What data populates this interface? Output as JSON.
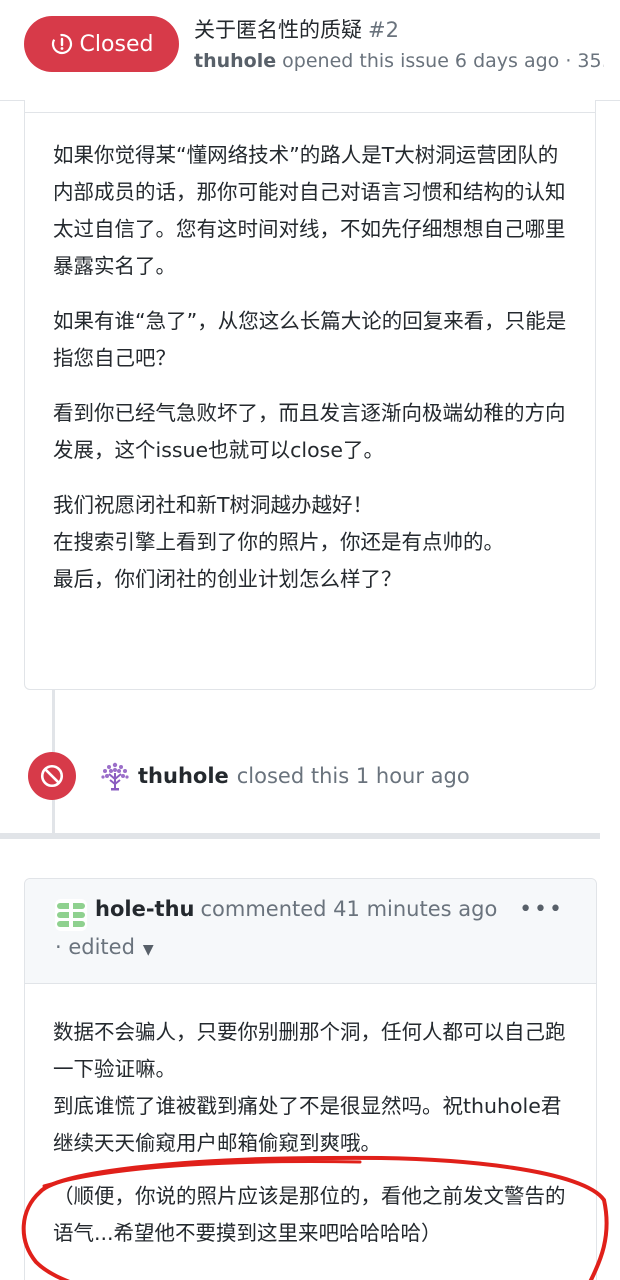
{
  "header": {
    "state_label": "Closed",
    "title": "关于匿名性的质疑",
    "number": "#2",
    "meta_author": "thuhole",
    "meta_rest": "opened this issue 6 days ago · 35…"
  },
  "comment1": {
    "paragraphs": [
      "如果你觉得某“懂网络技术”的路人是T大树洞运营团队的内部成员的话，那你可能对自己对语言习惯和结构的认知太过自信了。您有这时间对线，不如先仔细想想自己哪里暴露实名了。",
      "如果有谁“急了”，从您这么长篇大论的回复来看，只能是指您自己吧？",
      "看到你已经气急败坏了，而且发言逐渐向极端幼稚的方向发展，这个issue也就可以close了。"
    ],
    "last_lines": [
      "我们祝愿闭社和新T树洞越办越好！",
      "在搜索引擎上看到了你的照片，你还是有点帅的。",
      "最后，你们闭社的创业计划怎么样了？"
    ]
  },
  "event": {
    "icon": "closed-circle-slash-icon",
    "author": "thuhole",
    "text": "closed this 1 hour ago"
  },
  "comment2": {
    "author": "hole-thu",
    "meta": "commented 41 minutes ago",
    "edited_label": "· edited",
    "menu_label": "•••",
    "lines": [
      "数据不会骗人，只要你别删那个洞，任何人都可以自己跑一下验证嘛。",
      "到底谁慌了谁被戳到痛处了不是很显然吗。祝thuhole君继续天天偷窥用户邮箱偷窥到爽哦。",
      "（顺便，你说的照片应该是那位的，看他之前发文警告的语气...希望他不要摸到这里来吧哈哈哈哈）"
    ]
  },
  "colors": {
    "closed_red": "#d73a49",
    "annotation_red": "#e0201a"
  }
}
